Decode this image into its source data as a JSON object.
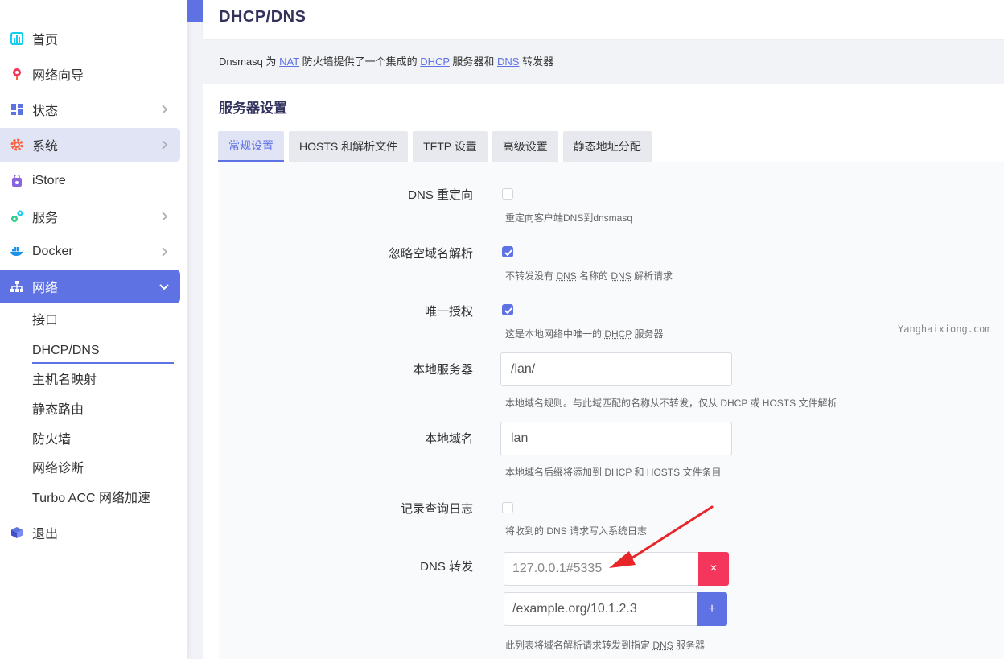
{
  "sidebar": {
    "items": [
      {
        "label": "首页",
        "icon": "dashboard-icon"
      },
      {
        "label": "网络向导",
        "icon": "wizard-icon"
      },
      {
        "label": "状态",
        "icon": "status-icon"
      },
      {
        "label": "系统",
        "icon": "gear-icon"
      },
      {
        "label": "iStore",
        "icon": "store-icon"
      },
      {
        "label": "服务",
        "icon": "services-icon"
      },
      {
        "label": "Docker",
        "icon": "docker-icon"
      },
      {
        "label": "网络",
        "icon": "network-icon"
      },
      {
        "label": "退出",
        "icon": "logout-icon"
      }
    ],
    "sub_items": [
      "接口",
      "DHCP/DNS",
      "主机名映射",
      "静态路由",
      "防火墙",
      "网络诊断",
      "Turbo ACC 网络加速"
    ],
    "accent_color": "#5e72e4"
  },
  "page": {
    "title": "DHCP/DNS",
    "desc": {
      "p1": "Dnsmasq 为 ",
      "nat": "NAT",
      "p2": " 防火墙提供了一个集成的 ",
      "dhcp": "DHCP",
      "p3": " 服务器和 ",
      "dns": "DNS",
      "p4": " 转发器"
    }
  },
  "section": {
    "title": "服务器设置",
    "tabs": [
      "常规设置",
      "HOSTS 和解析文件",
      "TFTP 设置",
      "高级设置",
      "静态地址分配"
    ]
  },
  "form": {
    "dns_redirect": {
      "label": "DNS 重定向",
      "checked": false,
      "help": "重定向客户端DNS到dnsmasq"
    },
    "domain_needed": {
      "label": "忽略空域名解析",
      "checked": true,
      "help_p1": "不转发没有 ",
      "help_dns1": "DNS",
      "help_p2": " 名称的 ",
      "help_dns2": "DNS",
      "help_p3": " 解析请求"
    },
    "authoritative": {
      "label": "唯一授权",
      "checked": true,
      "help_p1": "这是本地网络中唯一的 ",
      "help_dhcp": "DHCP",
      "help_p2": " 服务器"
    },
    "local_server": {
      "label": "本地服务器",
      "value": "/lan/",
      "help": "本地域名规则。与此域匹配的名称从不转发，仅从 DHCP 或 HOSTS 文件解析"
    },
    "local_domain": {
      "label": "本地域名",
      "value": "lan",
      "help": "本地域名后缀将添加到 DHCP 和 HOSTS 文件条目"
    },
    "log_queries": {
      "label": "记录查询日志",
      "checked": false,
      "help": "将收到的 DNS 请求写入系统日志"
    },
    "dns_forward": {
      "label": "DNS 转发",
      "entry_value": "127.0.0.1#5335",
      "placeholder": "/example.org/10.1.2.3",
      "remove_label": "×",
      "add_label": "+",
      "help_p1": "此列表将域名解析请求转发到指定 ",
      "help_dns": "DNS",
      "help_p2": " 服务器"
    }
  },
  "watermark": "Yanghaixiong.com",
  "colors": {
    "accent": "#5e72e4",
    "danger": "#f5365c",
    "arrow": "#e8262a"
  }
}
